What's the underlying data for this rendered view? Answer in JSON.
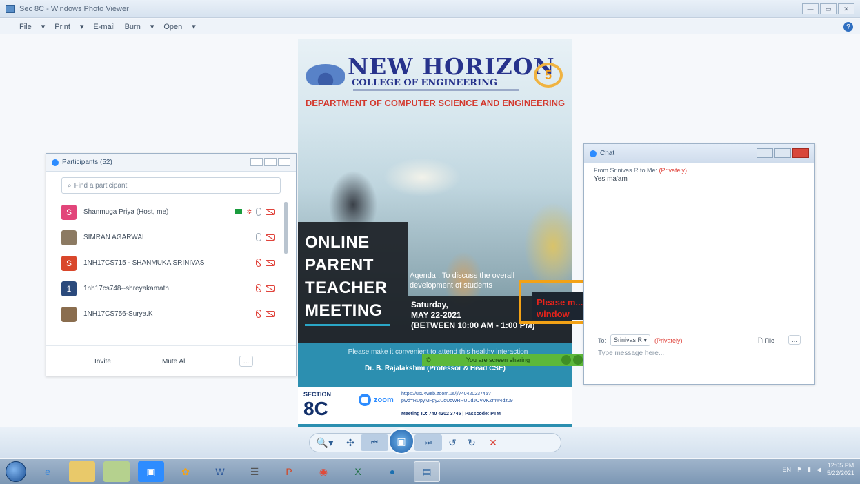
{
  "window": {
    "title": "Sec 8C - Windows Photo Viewer",
    "controls": [
      "—",
      "▭",
      "✕"
    ]
  },
  "menu": [
    {
      "label": "File"
    },
    {
      "label": "Print"
    },
    {
      "label": "E-mail"
    },
    {
      "label": "Burn"
    },
    {
      "label": "Open"
    }
  ],
  "poster": {
    "college_name": "NEW HORIZON",
    "college_sub": "COLLEGE OF ENGINEERING",
    "badge": "5",
    "department": "DEPARTMENT OF COMPUTER SCIENCE AND ENGINEERING",
    "title_lines": [
      "ONLINE",
      "PARENT",
      "TEACHER",
      "MEETING"
    ],
    "agenda": "Agenda : To discuss the overall development of students",
    "date_line1": "Saturday,",
    "date_line2": "MAY 22-2021",
    "date_line3": "(BETWEEN 10:00 AM - 1:00 PM)",
    "convenience": "Please make it convenient to attend this healthy interaction",
    "signature": "Dr. B. Rajalakshmi (Professor & Head CSE)",
    "section_label": "SECTION",
    "section": "8C",
    "zoom_label": "zoom",
    "meeting_link": "https://us04web.zoom.us/j/74042023745?pwd=RUpyMFgyZUdUcWRRUUdJOVVKZmw4dz09",
    "meeting_info": "Meeting ID: 740 4202 3745 | Passcode: PTM"
  },
  "overlay_text": "Please m... window w...",
  "sharing": {
    "label": "You are screen sharing"
  },
  "participants": {
    "title": "Participants (52)",
    "search_placeholder": "Find a participant",
    "rows": [
      {
        "initial": "S",
        "name": "Shanmuga Priya (Host, me)",
        "color": "#e2457a"
      },
      {
        "initial": "",
        "name": "SIMRAN AGARWAL",
        "color": "#8c7a62"
      },
      {
        "initial": "S",
        "name": "1NH17CS715 - SHANMUKA SRINIVAS",
        "color": "#d9472b"
      },
      {
        "initial": "1",
        "name": "1nh17cs748--shreyakamath",
        "color": "#2b4a7c"
      },
      {
        "initial": "",
        "name": "1NH17CS756-Surya.K",
        "color": "#8a6d4e"
      }
    ],
    "invite_label": "Invite",
    "mute_all_label": "Mute All",
    "more_label": "..."
  },
  "chat": {
    "title": "Chat",
    "from": "From Srinivas R to Me:",
    "privacy": "(Privately)",
    "message": "Yes ma'am",
    "to_label": "To:",
    "recipient": "Srinivas R ▾",
    "recipient_privacy": "(Privately)",
    "file_label": "File",
    "more_label": "...",
    "input_placeholder": "Type message here..."
  },
  "viewer_toolbar": {
    "zoom": "🔍▾",
    "fit": "✣",
    "prev": "⏮",
    "slideshow": "▣",
    "next": "⏭",
    "rotate_ccw": "↺",
    "rotate_cw": "↻",
    "delete": "✕"
  },
  "taskbar": {
    "language": "EN",
    "time": "12:05 PM",
    "date": "5/22/2021"
  }
}
